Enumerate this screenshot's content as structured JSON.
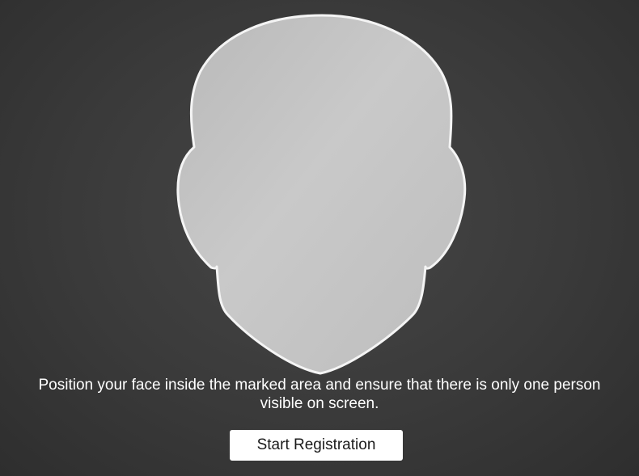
{
  "instruction": {
    "text": "Position your face inside the marked area and ensure that there is only one person visible on screen."
  },
  "actions": {
    "start_label": "Start Registration"
  },
  "colors": {
    "background": "#3a3a3a",
    "face_fill": "#c4c4c4",
    "face_outline": "#ffffff",
    "button_background": "#ffffff",
    "text": "#ffffff"
  }
}
